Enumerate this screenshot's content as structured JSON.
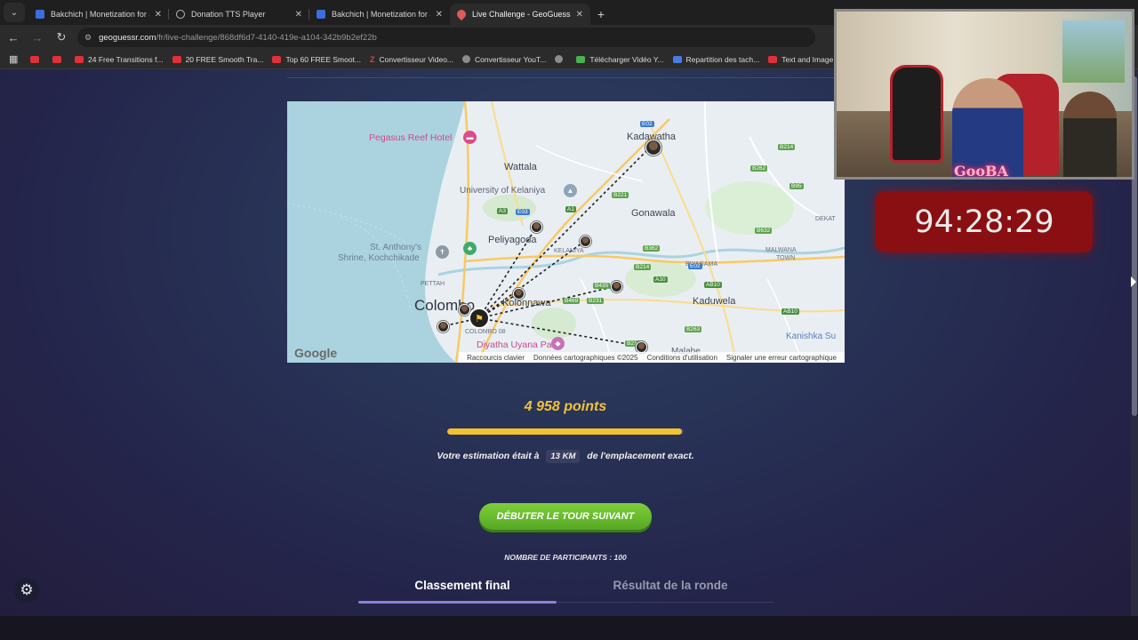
{
  "browser": {
    "tabs": [
      {
        "title": "Bakchich | Monetization for afri",
        "favicon": "b-logo-icon"
      },
      {
        "title": "Donation TTS Player",
        "favicon": "globe-icon"
      },
      {
        "title": "Bakchich | Monetization for afri",
        "favicon": "b-logo-icon"
      },
      {
        "title": "Live Challenge - GeoGuessr",
        "favicon": "map-pin-icon",
        "active": true
      }
    ],
    "url_domain": "geoguessr.com",
    "url_path": "/fr/live-challenge/868df6d7-4140-419e-a104-342b9b2ef22b",
    "bookmarks": [
      {
        "label": "",
        "icon": "youtube-icon"
      },
      {
        "label": "",
        "icon": "youtube-icon"
      },
      {
        "label": "24 Free Transitions f...",
        "icon": "youtube-icon"
      },
      {
        "label": "20 FREE Smooth Tra...",
        "icon": "youtube-icon"
      },
      {
        "label": "Top 60 FREE Smoot...",
        "icon": "youtube-icon"
      },
      {
        "label": "Convertisseur Video...",
        "icon": "z-icon"
      },
      {
        "label": "Convertisseur YouT...",
        "icon": "gray-icon"
      },
      {
        "label": "",
        "icon": "globe-icon"
      },
      {
        "label": "Télécharger Vidéo Y...",
        "icon": "download-icon"
      },
      {
        "label": "Repartition des tach...",
        "icon": "doc-icon"
      },
      {
        "label": "Text and Image ani...",
        "icon": "youtube-icon"
      }
    ]
  },
  "map": {
    "labels": {
      "pegasus": "Pegasus Reef Hotel",
      "kadawatha": "Kadawatha",
      "wattala": "Wattala",
      "kelaniya_uni": "University of Kelaniya",
      "gonawala": "Gonawala",
      "peliyagoda": "Peliyagoda",
      "anthony": "St. Anthony's",
      "shrine": "Shrine, Kochchikade",
      "pettah": "PETTAH",
      "colombo": "Colombo",
      "colombo08": "COLOMBO 08",
      "kolonnawa": "Kolonnawa",
      "kaduwela": "Kaduwela",
      "biyagama": "BIYAGAMA",
      "malwana": "MALWANA",
      "town": "TOWN",
      "dekata": "DEKAT",
      "diyatha": "Diyatha Uyana Park",
      "kanishka": "Kanishka Su",
      "malabe": "Malabe",
      "kelaniya": "KELANIYA"
    },
    "road_shields": [
      "E02",
      "B214",
      "B262",
      "B221",
      "B95",
      "A1",
      "B632",
      "E03",
      "A3",
      "B362",
      "B214",
      "A10",
      "E02",
      "AB10",
      "B435",
      "B469",
      "B231",
      "AB10",
      "B263",
      "B214"
    ],
    "google": "Google",
    "attribution": [
      "Raccourcis clavier",
      "Données cartographiques ©2025",
      "Conditions d'utilisation",
      "Signaler une erreur cartographique"
    ]
  },
  "result": {
    "points": "4 958 points",
    "score_fraction": 0.9916,
    "estimate_before": "Votre estimation était à",
    "distance": "13 KM",
    "estimate_after": "de l'emplacement exact.",
    "next_button": "DÉBUTER LE TOUR SUIVANT",
    "participants": "NOMBRE DE PARTICIPANTS : 100",
    "tabs": [
      "Classement final",
      "Résultat de la ronde"
    ]
  },
  "overlay": {
    "neon_sign": "GooBA",
    "timer": "94:28:29"
  },
  "colors": {
    "accent_gold": "#f2c23a",
    "button_green": "#6cbf2f",
    "timer_red": "#8a0f12",
    "tab_underline": "#8e7fd6"
  }
}
